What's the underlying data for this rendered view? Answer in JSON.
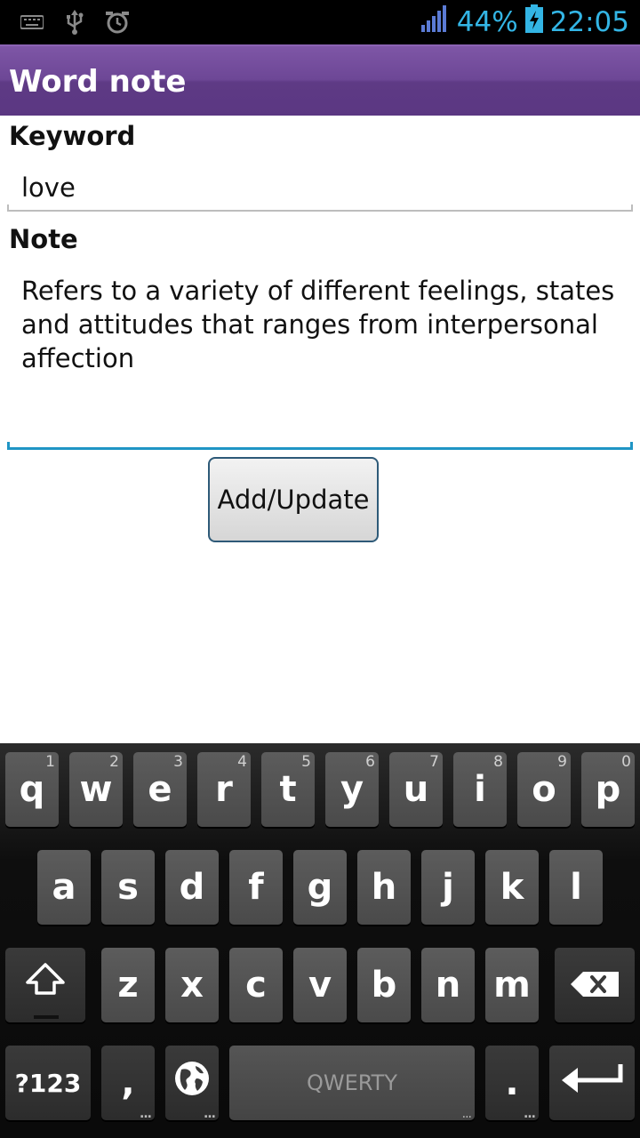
{
  "status_bar": {
    "battery": "44%",
    "time": "22:05",
    "icons": [
      "keyboard-icon",
      "usb-icon",
      "alarm-icon",
      "signal-icon",
      "battery-charging-icon"
    ]
  },
  "app": {
    "title": "Word note"
  },
  "form": {
    "keyword_label": "Keyword",
    "keyword_value": "love",
    "note_label": "Note",
    "note_value": "Refers to a variety of different feelings, states and attitudes that ranges from interpersonal affection",
    "submit_label": "Add/Update"
  },
  "keyboard": {
    "row1": [
      {
        "key": "q",
        "hint": "1"
      },
      {
        "key": "w",
        "hint": "2"
      },
      {
        "key": "e",
        "hint": "3"
      },
      {
        "key": "r",
        "hint": "4"
      },
      {
        "key": "t",
        "hint": "5"
      },
      {
        "key": "y",
        "hint": "6"
      },
      {
        "key": "u",
        "hint": "7"
      },
      {
        "key": "i",
        "hint": "8"
      },
      {
        "key": "o",
        "hint": "9"
      },
      {
        "key": "p",
        "hint": "0"
      }
    ],
    "row2": [
      "a",
      "s",
      "d",
      "f",
      "g",
      "h",
      "j",
      "k",
      "l"
    ],
    "row3": [
      "z",
      "x",
      "c",
      "v",
      "b",
      "n",
      "m"
    ],
    "symbols_label": "?123",
    "comma": ",",
    "space_label": "QWERTY",
    "period": ".",
    "icons": [
      "shift-icon",
      "backspace-icon",
      "globe-icon",
      "enter-icon"
    ]
  }
}
